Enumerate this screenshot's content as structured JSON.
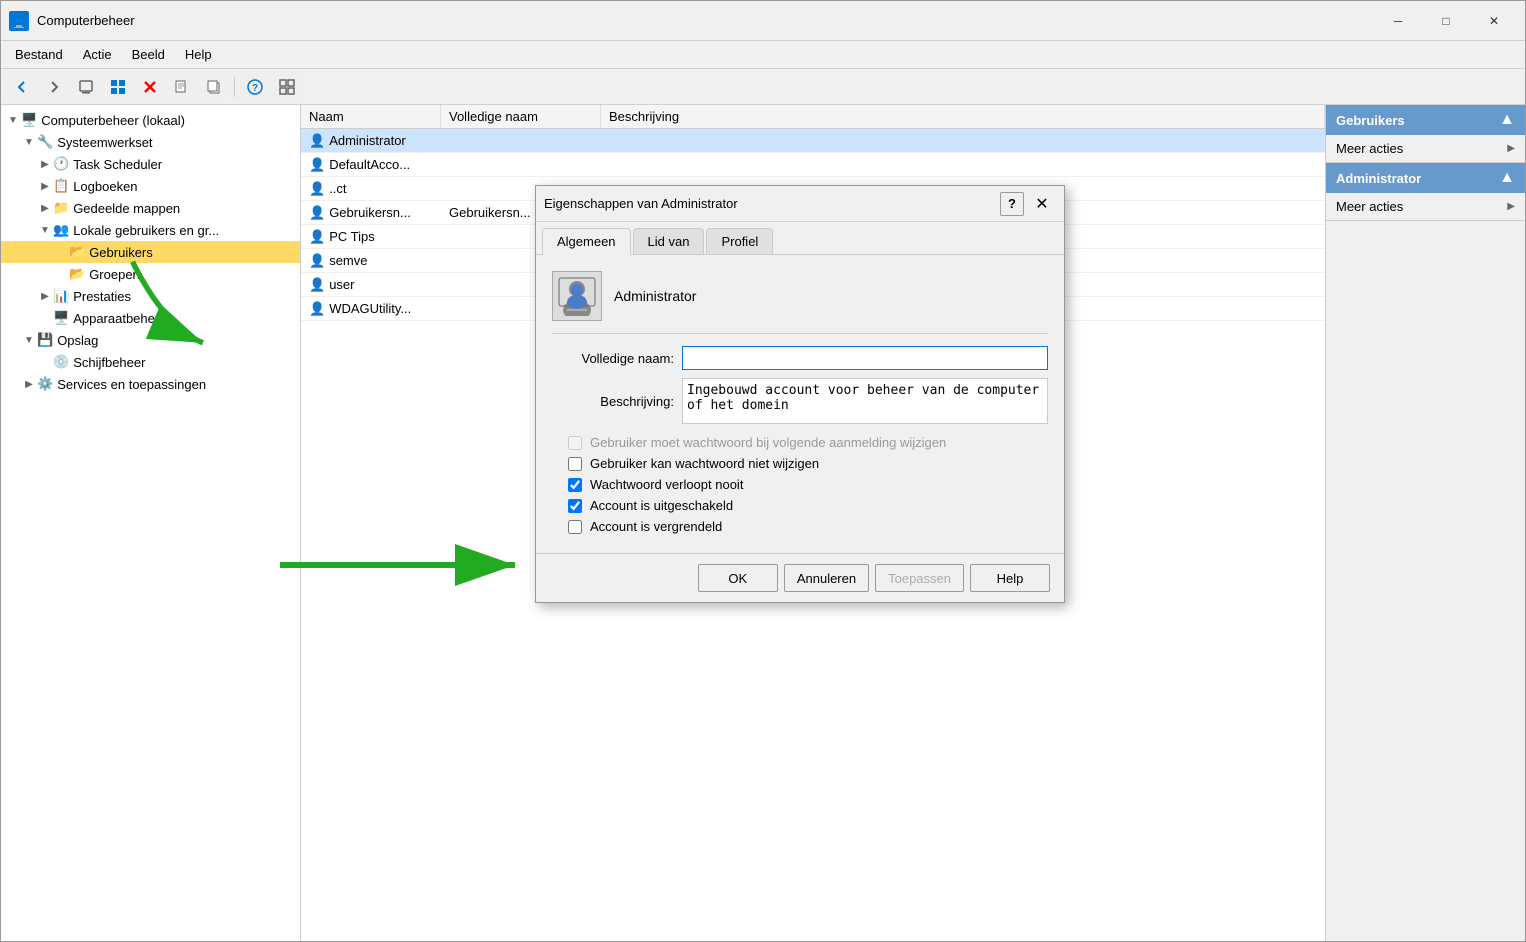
{
  "window": {
    "title": "Computerbeheer",
    "icon": "🖥️"
  },
  "titlebar": {
    "minimize": "─",
    "maximize": "□",
    "close": "✕"
  },
  "menubar": {
    "items": [
      "Bestand",
      "Actie",
      "Beeld",
      "Help"
    ]
  },
  "toolbar": {
    "buttons": [
      "←",
      "→",
      "📁",
      "▦",
      "✕",
      "📄",
      "📋",
      "?",
      "▦"
    ]
  },
  "tree": {
    "items": [
      {
        "label": "Computerbeheer (lokaal)",
        "level": 0,
        "icon": "🖥️",
        "expanded": true
      },
      {
        "label": "Systeemwerkset",
        "level": 1,
        "icon": "🔧",
        "expanded": true
      },
      {
        "label": "Task Scheduler",
        "level": 2,
        "icon": "🕐"
      },
      {
        "label": "Logboeken",
        "level": 2,
        "icon": "📋"
      },
      {
        "label": "Gedeelde mappen",
        "level": 2,
        "icon": "📁"
      },
      {
        "label": "Lokale gebruikers en gr...",
        "level": 2,
        "icon": "👥",
        "expanded": true
      },
      {
        "label": "Gebruikers",
        "level": 3,
        "icon": "📂",
        "selected": true
      },
      {
        "label": "Groepen",
        "level": 3,
        "icon": "📂"
      },
      {
        "label": "Prestaties",
        "level": 2,
        "icon": "📊"
      },
      {
        "label": "Apparaatbeheer",
        "level": 2,
        "icon": "🖥️"
      },
      {
        "label": "Opslag",
        "level": 1,
        "icon": "💾",
        "expanded": true
      },
      {
        "label": "Schijfbeheer",
        "level": 2,
        "icon": "💿"
      },
      {
        "label": "Services en toepassingen",
        "level": 1,
        "icon": "⚙️"
      }
    ]
  },
  "list_header": {
    "col1": "Naam",
    "col2": "Volledige naam",
    "col3": "Beschrijving"
  },
  "users": [
    {
      "name": "Administrator",
      "fullname": "",
      "description": ""
    },
    {
      "name": "DefaultAcco...",
      "fullname": "",
      "description": ""
    },
    {
      "name": "..ct",
      "fullname": "",
      "description": ""
    },
    {
      "name": "Gebruikersn...",
      "fullname": "Gebruikersn...",
      "description": ""
    },
    {
      "name": "PC Tips",
      "fullname": "",
      "description": ""
    },
    {
      "name": "semve",
      "fullname": "",
      "description": ""
    },
    {
      "name": "user",
      "fullname": "",
      "description": ""
    },
    {
      "name": "WDAGUtility...",
      "fullname": "",
      "description": ""
    }
  ],
  "acties": {
    "section1": {
      "header": "Gebruikers",
      "items": [
        "Meer acties"
      ]
    },
    "section2": {
      "header": "Administrator",
      "items": [
        "Meer acties"
      ]
    }
  },
  "dialog": {
    "title": "Eigenschappen van Administrator",
    "help_btn": "?",
    "close_btn": "✕",
    "tabs": [
      "Algemeen",
      "Lid van",
      "Profiel"
    ],
    "active_tab": "Algemeen",
    "avatar_icon": "👤",
    "username": "Administrator",
    "labels": {
      "volledige_naam": "Volledige naam:",
      "beschrijving": "Beschrijving:"
    },
    "volledigeNaam_value": "",
    "beschrijving_value": "Ingebouwd account voor beheer van de computer of het domein",
    "checkboxes": [
      {
        "label": "Gebruiker moet wachtwoord bij volgende aanmelding wijzigen",
        "checked": false,
        "disabled": true
      },
      {
        "label": "Gebruiker kan wachtwoord niet wijzigen",
        "checked": false,
        "disabled": false
      },
      {
        "label": "Wachtwoord verloopt nooit",
        "checked": true,
        "disabled": false
      },
      {
        "label": "Account is uitgeschakeld",
        "checked": true,
        "disabled": false
      },
      {
        "label": "Account is vergrendeld",
        "checked": false,
        "disabled": false
      }
    ],
    "buttons": {
      "ok": "OK",
      "annuleren": "Annuleren",
      "toepassen": "Toepassen",
      "help": "Help"
    }
  }
}
